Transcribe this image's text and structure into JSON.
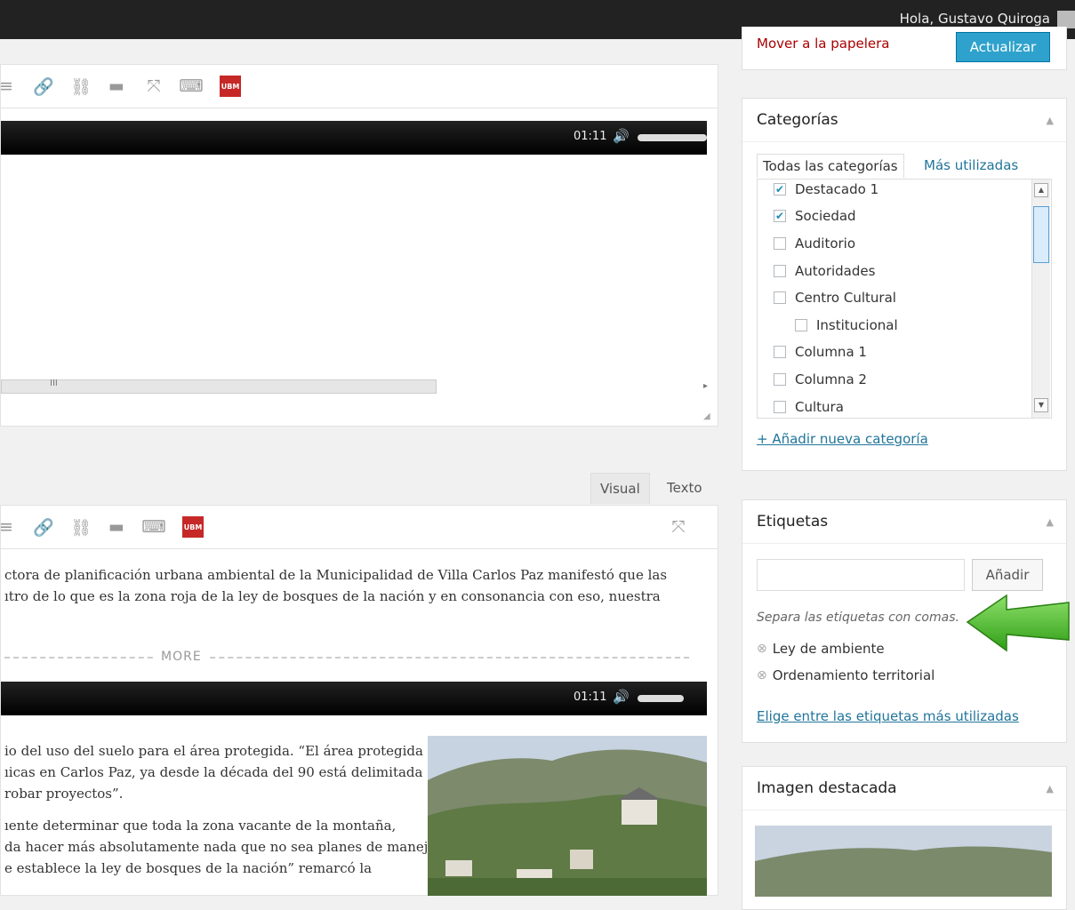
{
  "adminbar": {
    "greeting": "Hola, Gustavo Quiroga"
  },
  "publish": {
    "trash_label": "Mover a la papelera",
    "update_label": "Actualizar"
  },
  "editor1": {
    "player_time": "01:11",
    "scroll_marker": "III"
  },
  "editor2": {
    "tab_visual": "Visual",
    "tab_text": "Texto",
    "paragraph1": [
      "ctora de planificación urbana ambiental de la Municipalidad de Villa Carlos Paz manifestó que las",
      "ıtro de lo que es la zona roja de la ley de bosques de la nación y en consonancia con eso, nuestra"
    ],
    "more_label": "MORE",
    "player_time": "01:11",
    "paragraph2": [
      "io del uso del suelo para el área protegida. “El área protegida es",
      "ıicas en Carlos Paz, ya desde la década del 90 está delimitada",
      "robar proyectos”."
    ],
    "paragraph3": [
      "ıente determinar que toda la zona vacante de la montaña,",
      "da hacer más absolutamente nada que no sea planes de manejo",
      "e establece la ley de bosques de la nación” remarcó la"
    ]
  },
  "categories": {
    "title": "Categorías",
    "tab_all": "Todas las categorías",
    "tab_most": "Más utilizadas",
    "items": [
      {
        "label": "Destacado 1",
        "checked": true
      },
      {
        "label": "Sociedad",
        "checked": true
      },
      {
        "label": "Auditorio",
        "checked": false
      },
      {
        "label": "Autoridades",
        "checked": false
      },
      {
        "label": "Centro Cultural",
        "checked": false
      },
      {
        "label": "Institucional",
        "checked": false
      },
      {
        "label": "Columna 1",
        "checked": false
      },
      {
        "label": "Columna 2",
        "checked": false
      },
      {
        "label": "Cultura",
        "checked": false
      }
    ],
    "add_link": "+ Añadir nueva categoría"
  },
  "tags": {
    "title": "Etiquetas",
    "add_button": "Añadir",
    "hint": "Separa las etiquetas con comas.",
    "items": [
      "Ley de ambiente",
      "Ordenamiento territorial"
    ],
    "choose_link": "Elige entre las etiquetas más utilizadas"
  },
  "featured": {
    "title": "Imagen destacada"
  },
  "colors": {
    "accent": "#2ea2cc",
    "link": "#21759b",
    "trash": "#a00",
    "arrow": "#3cb521"
  },
  "icons": {
    "check": "✔",
    "remove": "⊗",
    "collapse": "▲"
  }
}
